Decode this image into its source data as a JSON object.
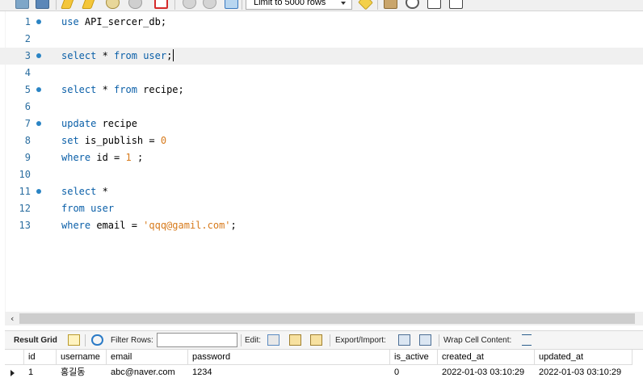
{
  "toolbar": {
    "limit_select": "Limit to 5000 rows",
    "icons": [
      "open-icon",
      "save-icon",
      "execute-icon",
      "execute-current-icon",
      "explain-icon",
      "stop-icon",
      "toggle-continue-icon",
      "commit-icon",
      "rollback-icon",
      "autocommit-icon",
      "beautify-icon",
      "find-icon",
      "invisible-chars-icon",
      "wrap-icon"
    ]
  },
  "editor": {
    "lines": [
      {
        "n": "1",
        "fold": true
      },
      {
        "n": "2",
        "fold": false
      },
      {
        "n": "3",
        "fold": true
      },
      {
        "n": "4",
        "fold": false
      },
      {
        "n": "5",
        "fold": true
      },
      {
        "n": "6",
        "fold": false
      },
      {
        "n": "7",
        "fold": true
      },
      {
        "n": "8",
        "fold": false
      },
      {
        "n": "9",
        "fold": false
      },
      {
        "n": "10",
        "fold": false
      },
      {
        "n": "11",
        "fold": true
      },
      {
        "n": "12",
        "fold": false
      },
      {
        "n": "13",
        "fold": false
      }
    ],
    "code": {
      "l1_kw": "use",
      "l1_rest": " API_sercer_db;",
      "l3_kw1": "select",
      "l3_mid": " * ",
      "l3_kw2": "from",
      "l3_sp": " ",
      "l3_kw3": "user",
      "l3_end": ";",
      "l5_kw1": "select",
      "l5_mid": " * ",
      "l5_kw2": "from",
      "l5_end": " recipe;",
      "l7_kw": "update",
      "l7_rest": " recipe",
      "l8_kw": "set",
      "l8_rest": " is_publish = ",
      "l8_num": "0",
      "l9_kw": "where",
      "l9_rest": " id = ",
      "l9_num": "1",
      "l9_end": " ;",
      "l11_kw": "select",
      "l11_rest": " *",
      "l12_kw1": "from",
      "l12_sp": " ",
      "l12_kw2": "user",
      "l13_kw": "where",
      "l13_rest": " email = ",
      "l13_str": "'qqq@gamil.com'",
      "l13_end": ";"
    }
  },
  "result_toolbar": {
    "result_grid": "Result Grid",
    "filter_rows": "Filter Rows:",
    "edit": "Edit:",
    "export_import": "Export/Import:",
    "wrap_cell": "Wrap Cell Content:"
  },
  "grid": {
    "columns": [
      "id",
      "username",
      "email",
      "password",
      "is_active",
      "created_at",
      "updated_at"
    ],
    "rows": [
      [
        "1",
        "홍길동",
        "abc@naver.com",
        "1234",
        "0",
        "2022-01-03 03:10:29",
        "2022-01-03 03:10:29"
      ]
    ]
  }
}
